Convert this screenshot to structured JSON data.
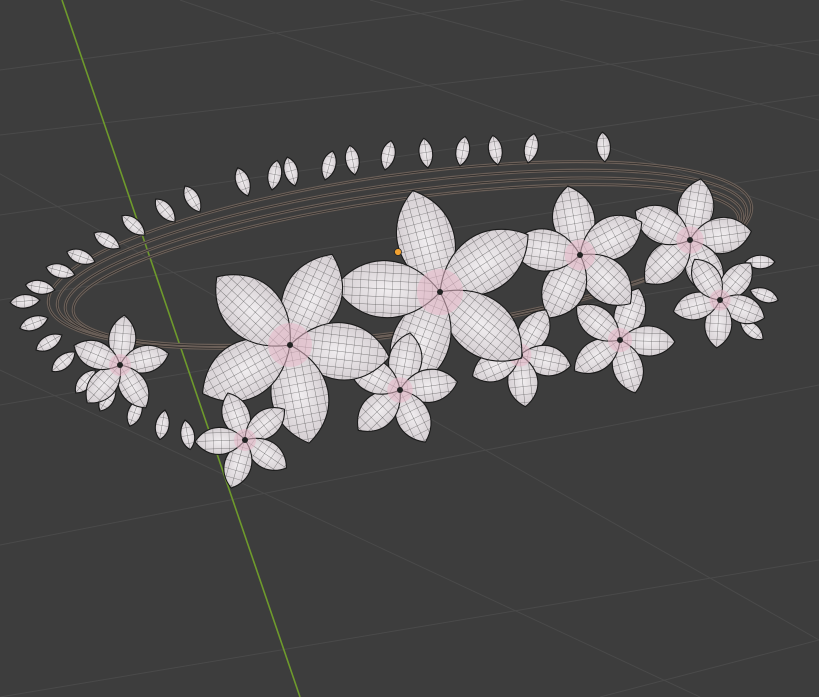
{
  "viewport": {
    "background_color": "#3d3d3d",
    "grid_line_color": "#4a4a4a",
    "y_axis_color": "#6e9a2c",
    "scene_object": "flower-crown",
    "display_mode": "wireframe-over-solid",
    "overlays": [
      "grid-floor",
      "y-axis-line",
      "object-origin"
    ]
  },
  "scene": {
    "petal_fill_color": "#e9e2e6",
    "petal_center_tint": "#e7b8c8",
    "wire_color": "#1a1a1a",
    "vine_color": "#6a5f58",
    "origin_color": "#f0a030"
  }
}
